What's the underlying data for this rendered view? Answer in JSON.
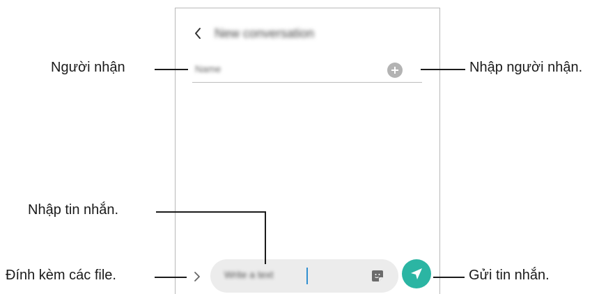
{
  "screen": {
    "title": "New conversation",
    "recipient_hint": "Name",
    "message_placeholder": "Write a text"
  },
  "callouts": {
    "recipient": "Người nhận",
    "enter_recipient": "Nhập người nhận.",
    "enter_message": "Nhập tin nhắn.",
    "attach_files": "Đính kèm các file.",
    "send_message": "Gửi tin nhắn."
  },
  "icons": {
    "back": "chevron-left-icon",
    "add_recipient": "plus-circle-icon",
    "attach": "chevron-right-icon",
    "sticker": "sticker-icon",
    "send": "paper-plane-icon"
  },
  "colors": {
    "send_button": "#2bb5a3",
    "cursor": "#2f8fd0",
    "input_bg": "#ececec"
  }
}
